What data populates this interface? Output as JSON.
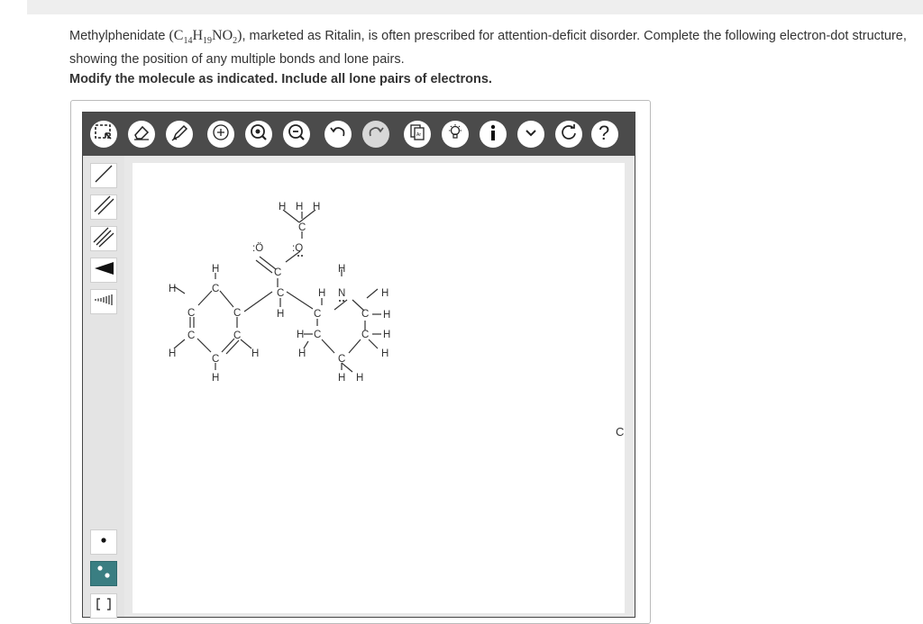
{
  "question": {
    "intro": "Methylphenidate",
    "formula_parts": [
      "C",
      "14",
      "H",
      "19",
      "NO",
      "2"
    ],
    "after_formula": ", marketed as Ritalin, is often prescribed for attention-deficit disorder. Complete the following electron-dot structure, showing the position of any multiple bonds and lone pairs.",
    "instruction": "Modify the molecule as indicated. Include all lone pairs of electrons."
  },
  "toolbar": {
    "buttons": [
      "select-icon",
      "eraser-icon",
      "pencil-icon",
      "zoom-in-icon",
      "zoom-fit-icon",
      "zoom-out-icon",
      "undo-icon",
      "redo-icon",
      "copy-template-icon",
      "hint-icon",
      "info-icon",
      "chevron-down-icon",
      "reset-icon",
      "help-icon"
    ]
  },
  "sidebar": {
    "tools": [
      "single-bond",
      "double-bond",
      "triple-bond",
      "wedge-bond",
      "hashed-bond",
      "single-electron",
      "lone-pair",
      "bracket"
    ]
  },
  "molecule": {
    "atoms": {
      "carbon": "C",
      "hydrogen": "H",
      "nitrogen": "N",
      "oxygen": "O",
      "oxygen_lp_left": ":Ö",
      "oxygen_lp_right": ":O"
    }
  },
  "stray_label": "C",
  "colors": {
    "toolbar_bg": "#4b4b4b",
    "active_tool": "#3a7e82"
  }
}
